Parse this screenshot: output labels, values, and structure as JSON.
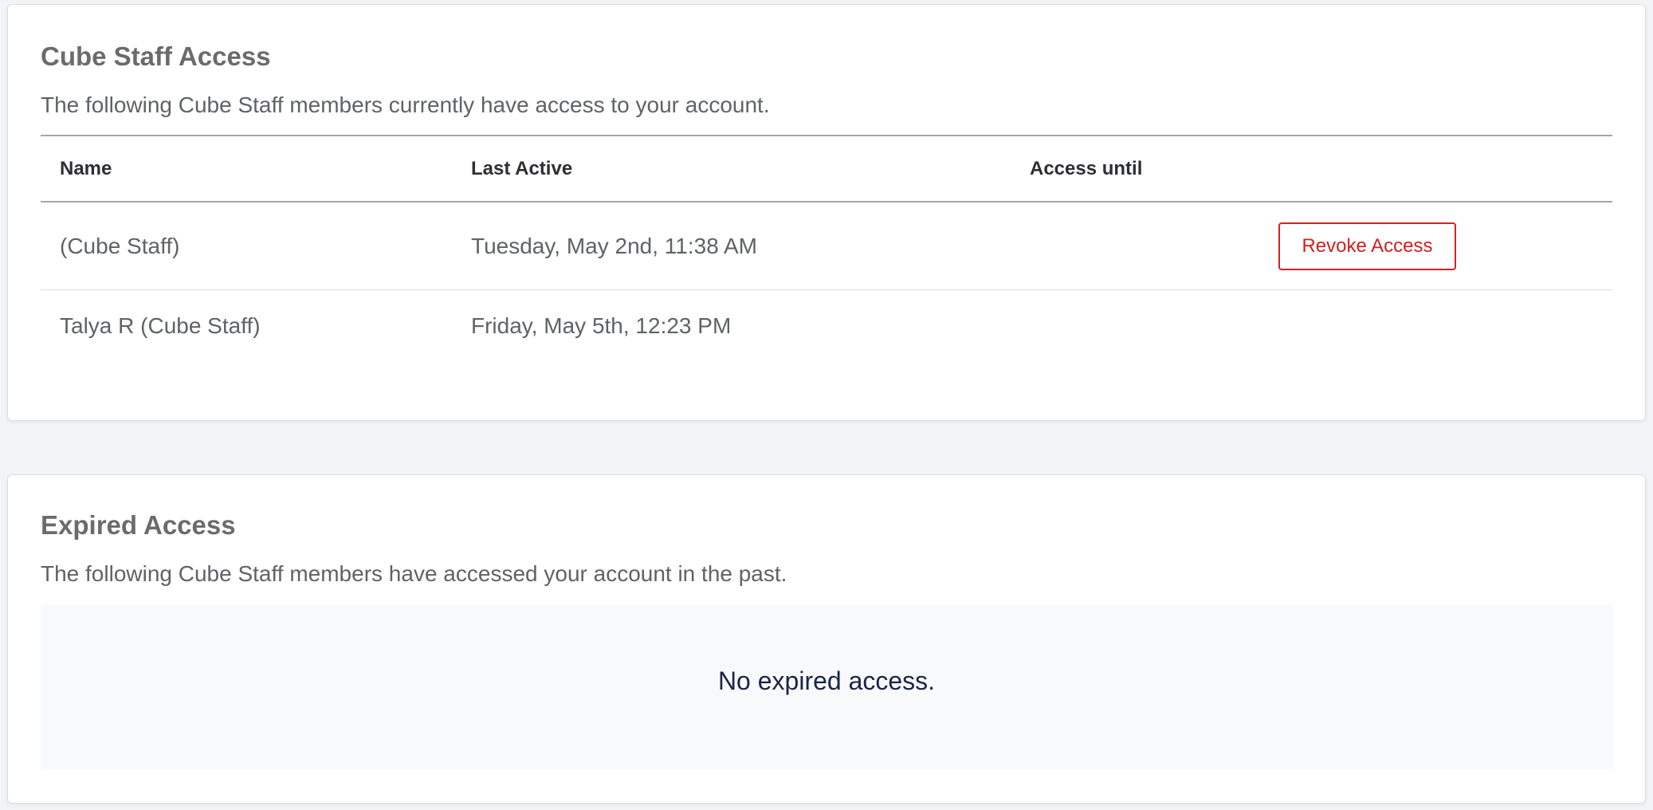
{
  "active_access": {
    "title": "Cube Staff Access",
    "description": "The following Cube Staff members currently have access to your account.",
    "columns": {
      "name": "Name",
      "last_active": "Last Active",
      "access_until": "Access until"
    },
    "rows": [
      {
        "name": "(Cube Staff)",
        "last_active": "Tuesday, May 2nd, 11:38 AM",
        "access_until": "",
        "action_label": "Revoke Access"
      },
      {
        "name": "Talya R (Cube Staff)",
        "last_active": "Friday, May 5th, 12:23 PM",
        "access_until": ""
      }
    ]
  },
  "expired_access": {
    "title": "Expired Access",
    "description": "The following Cube Staff members have accessed your account in the past.",
    "empty_message": "No expired access."
  },
  "colors": {
    "revoke_button": "#d32222",
    "empty_text": "#1a2547",
    "empty_background": "#f8f9fb"
  }
}
